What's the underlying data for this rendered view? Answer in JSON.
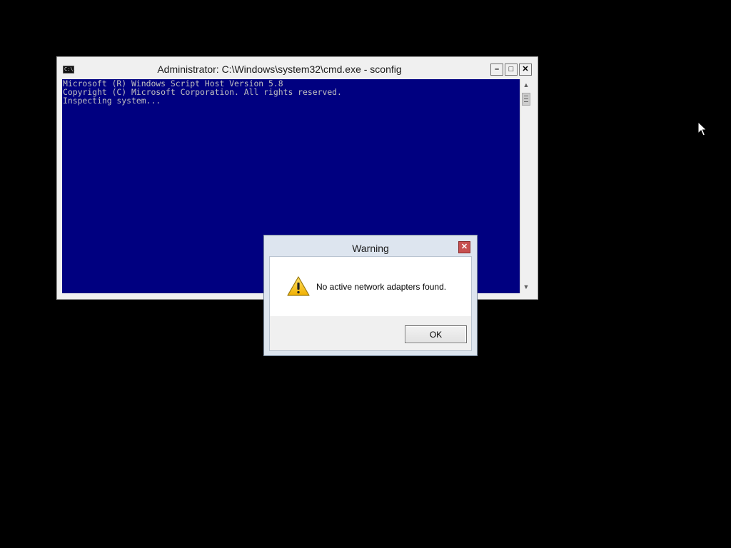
{
  "console_window": {
    "title": "Administrator: C:\\Windows\\system32\\cmd.exe - sconfig",
    "system_icon_text": "C:\\.",
    "minimize_glyph": "–",
    "maximize_glyph": "□",
    "close_glyph": "✕",
    "lines": [
      "Microsoft (R) Windows Script Host Version 5.8",
      "Copyright (C) Microsoft Corporation. All rights reserved.",
      "",
      "Inspecting system..."
    ],
    "background_color": "#000080",
    "text_color": "#c0c0c0"
  },
  "warning_dialog": {
    "title": "Warning",
    "message": "No active network adapters found.",
    "ok_label": "OK",
    "icon": "warning-icon",
    "close_color": "#c75050"
  },
  "cursor": {
    "icon": "mouse-pointer-icon"
  }
}
